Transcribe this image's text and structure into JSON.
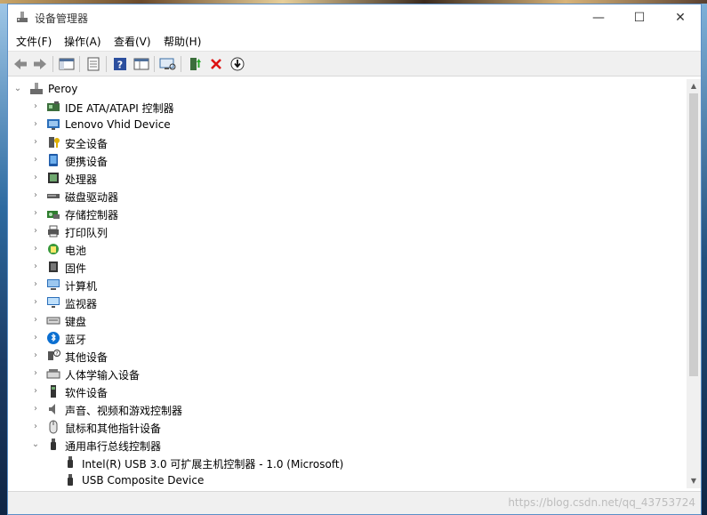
{
  "window": {
    "title": "设备管理器",
    "controls": {
      "minimize": "—",
      "maximize": "☐",
      "close": "✕"
    }
  },
  "menu": [
    {
      "label": "文件(F)"
    },
    {
      "label": "操作(A)"
    },
    {
      "label": "查看(V)"
    },
    {
      "label": "帮助(H)"
    }
  ],
  "toolbar": {
    "buttons": [
      "back-arrow-icon",
      "forward-arrow-icon",
      "console-tree-icon",
      "properties-icon",
      "help-icon",
      "view-icon",
      "scan-hardware-icon",
      "update-driver-icon",
      "uninstall-device-icon",
      "download-icon"
    ]
  },
  "tree": {
    "root": "Peroy",
    "categories": [
      {
        "label": "IDE ATA/ATAPI 控制器",
        "icon": "ide-controller-icon",
        "expanded": false
      },
      {
        "label": "Lenovo Vhid Device",
        "icon": "hid-device-icon",
        "expanded": false
      },
      {
        "label": "安全设备",
        "icon": "security-device-icon",
        "expanded": false
      },
      {
        "label": "便携设备",
        "icon": "portable-device-icon",
        "expanded": false
      },
      {
        "label": "处理器",
        "icon": "processor-icon",
        "expanded": false
      },
      {
        "label": "磁盘驱动器",
        "icon": "disk-drive-icon",
        "expanded": false
      },
      {
        "label": "存储控制器",
        "icon": "storage-controller-icon",
        "expanded": false
      },
      {
        "label": "打印队列",
        "icon": "printer-icon",
        "expanded": false
      },
      {
        "label": "电池",
        "icon": "battery-icon",
        "expanded": false
      },
      {
        "label": "固件",
        "icon": "firmware-icon",
        "expanded": false
      },
      {
        "label": "计算机",
        "icon": "computer-icon",
        "expanded": false
      },
      {
        "label": "监视器",
        "icon": "monitor-icon",
        "expanded": false
      },
      {
        "label": "键盘",
        "icon": "keyboard-icon",
        "expanded": false
      },
      {
        "label": "蓝牙",
        "icon": "bluetooth-icon",
        "expanded": false
      },
      {
        "label": "其他设备",
        "icon": "unknown-device-icon",
        "expanded": false
      },
      {
        "label": "人体学输入设备",
        "icon": "hid-input-icon",
        "expanded": false
      },
      {
        "label": "软件设备",
        "icon": "software-device-icon",
        "expanded": false
      },
      {
        "label": "声音、视频和游戏控制器",
        "icon": "speaker-icon",
        "expanded": false
      },
      {
        "label": "鼠标和其他指针设备",
        "icon": "mouse-icon",
        "expanded": false
      },
      {
        "label": "通用串行总线控制器",
        "icon": "usb-icon",
        "expanded": true
      }
    ],
    "usb_children": [
      {
        "label": "Intel(R) USB 3.0 可扩展主机控制器 - 1.0 (Microsoft)",
        "icon": "usb-plug-icon"
      },
      {
        "label": "USB Composite Device",
        "icon": "usb-plug-icon"
      }
    ]
  },
  "statusbar": {
    "watermark": "https://blog.csdn.net/qq_43753724"
  }
}
